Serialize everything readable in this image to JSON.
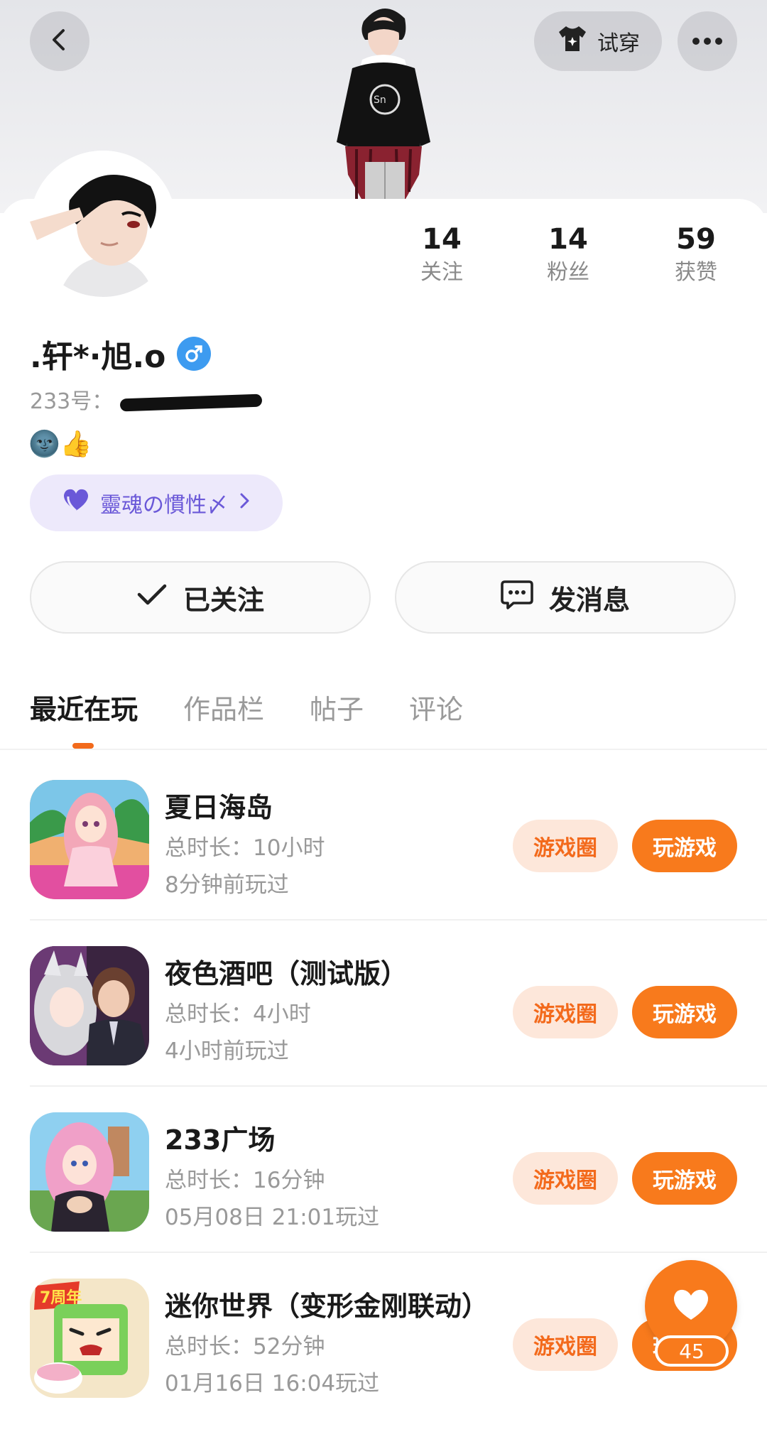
{
  "header": {
    "back_icon": "chevron-left-icon",
    "try_on_label": "试穿",
    "try_on_icon": "shirt-icon",
    "more_icon": "more-dots-icon"
  },
  "profile": {
    "username": ".轩*·旭.o",
    "gender_icon": "male-icon",
    "uid_label": "233号：",
    "uid_value": "",
    "bio_emoji": "🌚👍",
    "group_label": "靈魂の慣性〆",
    "group_icon": "heart-icon"
  },
  "stats": [
    {
      "num": "14",
      "label": "关注"
    },
    {
      "num": "14",
      "label": "粉丝"
    },
    {
      "num": "59",
      "label": "获赞"
    }
  ],
  "actions": {
    "follow_label": "已关注",
    "message_label": "发消息"
  },
  "tabs": [
    {
      "label": "最近在玩",
      "active": true
    },
    {
      "label": "作品栏",
      "active": false
    },
    {
      "label": "帖子",
      "active": false
    },
    {
      "label": "评论",
      "active": false
    }
  ],
  "games": [
    {
      "name": "夏日海岛",
      "duration": "总时长：10小时",
      "last_played": "8分钟前玩过",
      "circle_label": "游戏圈",
      "play_label": "玩游戏"
    },
    {
      "name": "夜色酒吧（测试版）",
      "duration": "总时长：4小时",
      "last_played": "4小时前玩过",
      "circle_label": "游戏圈",
      "play_label": "玩游戏"
    },
    {
      "name": "233广场",
      "duration": "总时长：16分钟",
      "last_played": "05月08日 21:01玩过",
      "circle_label": "游戏圈",
      "play_label": "玩游戏"
    },
    {
      "name": "迷你世界（变形金刚联动）",
      "duration": "总时长：52分钟",
      "last_played": "01月16日 16:04玩过",
      "circle_label": "游戏圈",
      "play_label": "玩游戏"
    }
  ],
  "like_fab": {
    "count": "45",
    "icon": "heart-icon"
  },
  "colors": {
    "accent": "#f87a1c",
    "accent_light": "#fde7da",
    "group_bg": "#ede9fb",
    "group_text": "#6a58d8",
    "gender_blue": "#3d9bf0"
  }
}
